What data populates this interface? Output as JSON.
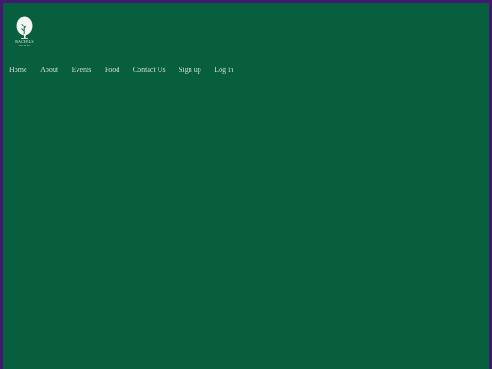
{
  "brand": {
    "name": "RACHELS",
    "tagline": "ORCHARD",
    "logo_icon": "tree-icon"
  },
  "nav": {
    "items": [
      {
        "label": "Home"
      },
      {
        "label": "About"
      },
      {
        "label": "Events"
      },
      {
        "label": "Food"
      },
      {
        "label": "Contact Us"
      },
      {
        "label": "Sign up"
      },
      {
        "label": "Log in"
      }
    ]
  },
  "colors": {
    "frame": "#3f1a6e",
    "background": "#075f3e",
    "nav_text": "#d2dfd8"
  }
}
